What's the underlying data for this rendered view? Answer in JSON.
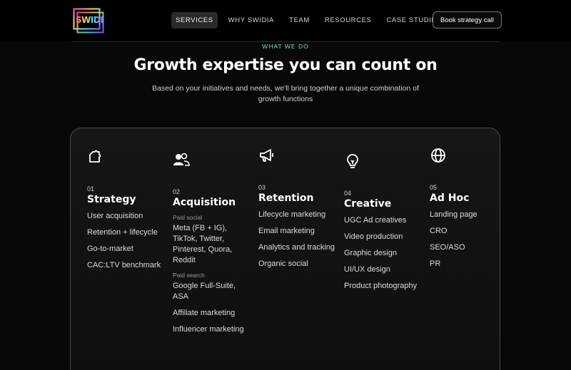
{
  "brand": {
    "logo_text": "SWIDIA"
  },
  "nav": {
    "items": [
      {
        "label": "SERVICES",
        "active": true
      },
      {
        "label": "WHY SWIDIA",
        "active": false
      },
      {
        "label": "TEAM",
        "active": false
      },
      {
        "label": "RESOURCES",
        "active": false
      },
      {
        "label": "CASE STUDIES",
        "active": false
      }
    ],
    "cta_label": "Book strategy call"
  },
  "hero": {
    "eyebrow": "WHAT WE DO",
    "headline": "Growth expertise you can count on",
    "subhead": "Based on your initiatives and needs, we'll bring together a unique combination of growth functions"
  },
  "services": [
    {
      "icon": "puzzle-icon",
      "number": "01",
      "title": "Strategy",
      "items": [
        "User acquisition",
        "Retention + lifecycle",
        "Go-to-market",
        "CAC:LTV benchmark"
      ]
    },
    {
      "icon": "users-icon",
      "number": "02",
      "title": "Acquisition",
      "paid_social_label": "Paid social",
      "paid_social": "Meta (FB + IG), TikTok, Twitter, Pinterest, Quora, Reddit",
      "paid_search_label": "Paid search",
      "paid_search": "Google Full-Suite, ASA",
      "items": [
        "Affiliate marketing",
        "Influencer marketing"
      ]
    },
    {
      "icon": "megaphone-icon",
      "number": "03",
      "title": "Retention",
      "items": [
        "Lifecycle marketing",
        "Email marketing",
        "Analytics and tracking",
        "Organic social"
      ]
    },
    {
      "icon": "lightbulb-icon",
      "number": "04",
      "title": "Creative",
      "items": [
        "UGC Ad creatives",
        "Video production",
        "Graphic design",
        "UI/UX design",
        "Product photography"
      ]
    },
    {
      "icon": "globe-icon",
      "number": "05",
      "title": "Ad Hoc",
      "items": [
        "Landing page",
        "CRO",
        "SEO/ASO",
        "PR"
      ]
    }
  ]
}
